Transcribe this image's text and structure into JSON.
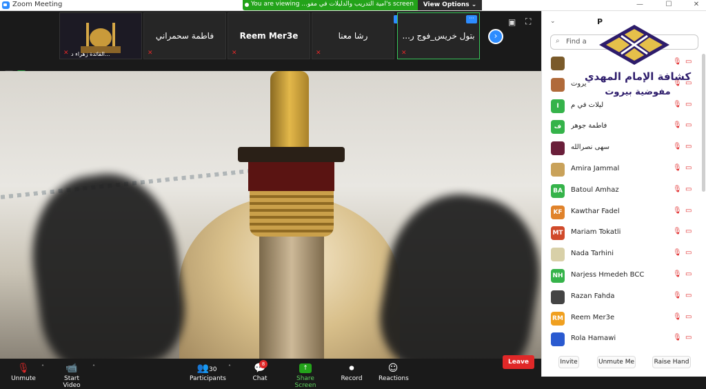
{
  "window": {
    "title": "Zoom Meeting",
    "minimize": "—",
    "maximize": "☐",
    "close": "✕"
  },
  "share_banner": {
    "text": "You are viewing ...امية التدريب والدليلات في مفو's screen",
    "view_options": "View Options ⌄"
  },
  "strip": {
    "tiles": [
      {
        "name": "",
        "caption": "القائدة زهراء د...",
        "has_image": true
      },
      {
        "name": "فاطمة سحمراني",
        "caption": ""
      },
      {
        "name": "Reem Mer3e",
        "caption": ""
      },
      {
        "name": "رشا معنا",
        "caption": ""
      },
      {
        "name": "...بتول خريس_فوج ر",
        "caption": ""
      }
    ],
    "more_label": "···",
    "next_label": "›"
  },
  "toolbar": {
    "unmute": "Unmute",
    "start_video": "Start Video",
    "participants": "Participants",
    "participants_count": "30",
    "chat": "Chat",
    "chat_badge": "8",
    "share_screen": "Share Screen",
    "record": "Record",
    "reactions": "Reactions",
    "leave": "Leave"
  },
  "panel": {
    "title": "P",
    "search_placeholder": "Find a",
    "participants": [
      {
        "initials": "",
        "name": "",
        "color": "#7a5a2a",
        "photo": true
      },
      {
        "initials": "",
        "name": "يروت",
        "color": "#b06a3a",
        "photo": true
      },
      {
        "initials": "I",
        "name": "ليلات في م",
        "color": "#35b34a"
      },
      {
        "initials": "ف",
        "name": "فاطمة جوهر",
        "color": "#35b34a"
      },
      {
        "initials": "",
        "name": "سهى نصرالله",
        "color": "#6a1f3a",
        "photo": true
      },
      {
        "initials": "",
        "name": "Amira Jammal",
        "color": "#c9a25a",
        "photo": true
      },
      {
        "initials": "BA",
        "name": "Batoul Amhaz",
        "color": "#35b34a"
      },
      {
        "initials": "KF",
        "name": "Kawthar Fadel",
        "color": "#e0822a"
      },
      {
        "initials": "MT",
        "name": "Mariam Tokatli",
        "color": "#d04a2a"
      },
      {
        "initials": "",
        "name": "Nada Tarhini",
        "color": "#d8d0a8",
        "photo": true
      },
      {
        "initials": "NH",
        "name": "Narjess Hmedeh BCC",
        "color": "#35b34a"
      },
      {
        "initials": "",
        "name": "Razan Fahda",
        "color": "#444444",
        "photo": true
      },
      {
        "initials": "RM",
        "name": "Reem Mer3e",
        "color": "#f0a020"
      },
      {
        "initials": "",
        "name": "Rola Hamawi",
        "color": "#2a5ad0",
        "photo": true
      }
    ],
    "invite": "Invite",
    "unmute_me": "Unmute Me",
    "raise_hand": "Raise Hand"
  },
  "logo": {
    "line1": "كشافة الإمام المهدي",
    "line2": "مفوضية بيروت"
  },
  "colors": {
    "zoom_blue": "#2d8cff",
    "share_green": "#23a31a",
    "leave_red": "#e02828",
    "logo_purple": "#2d1c6b",
    "logo_gold": "#e5c04a"
  }
}
